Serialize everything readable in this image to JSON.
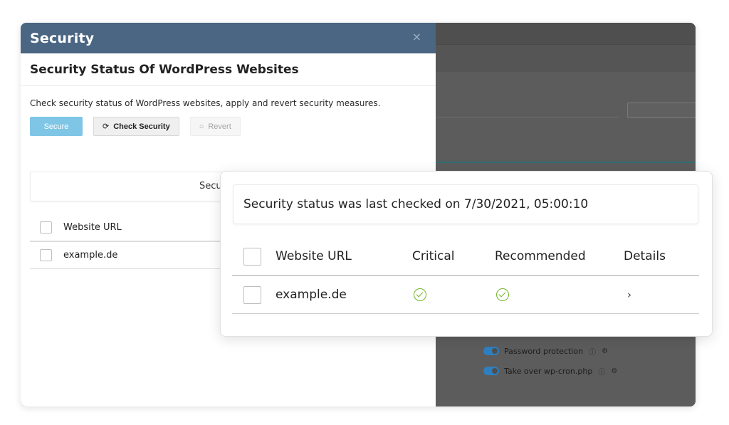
{
  "dialog": {
    "title": "Security",
    "close_glyph": "×",
    "subtitle": "Security Status Of WordPress Websites",
    "description": "Check security status of WordPress websites, apply and revert security measures.",
    "buttons": {
      "secure": "Secure",
      "check_security": "Check Security",
      "check_glyph": "⟳",
      "revert": "Revert",
      "revert_glyph": "○"
    },
    "section_label": "Secu",
    "table": {
      "header_url": "Website URL",
      "rows": [
        {
          "url": "example.de"
        }
      ]
    }
  },
  "background": {
    "toggles": [
      {
        "label": "Password protection",
        "help_icon": "ⓘ",
        "settings_icon": "⚙"
      },
      {
        "label": "Take over wp-cron.php",
        "help_icon": "ⓘ",
        "settings_icon": "⚙"
      }
    ]
  },
  "card": {
    "status_text": "Security status was last checked on 7/30/2021, 05:00:10",
    "columns": {
      "url": "Website URL",
      "critical": "Critical",
      "recommended": "Recommended",
      "details": "Details"
    },
    "rows": [
      {
        "url": "example.de",
        "critical": "ok",
        "recommended": "ok",
        "details_glyph": "›"
      }
    ]
  },
  "colors": {
    "header_bg": "#4a6682",
    "primary_button": "#7fc6e6",
    "check_green": "#73b52b",
    "toggle_blue": "#2e7fbf"
  }
}
